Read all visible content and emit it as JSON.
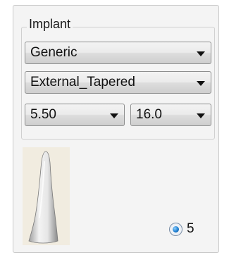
{
  "group": {
    "title": "Implant"
  },
  "combos": {
    "manufacturer": {
      "value": "Generic",
      "icon": "chevron-down-icon"
    },
    "type": {
      "value": "External_Tapered",
      "icon": "chevron-down-icon"
    },
    "diameter": {
      "value": "5.50",
      "icon": "chevron-down-icon"
    },
    "length": {
      "value": "16.0",
      "icon": "chevron-down-icon"
    }
  },
  "preview": {
    "icon": "implant-preview-image"
  },
  "option": {
    "label": "5",
    "selected": true
  },
  "colors": {
    "panel_bg": "#f4f4f4",
    "preview_bg": "#f1ece0",
    "radio_accent": "#1f7fd0"
  }
}
